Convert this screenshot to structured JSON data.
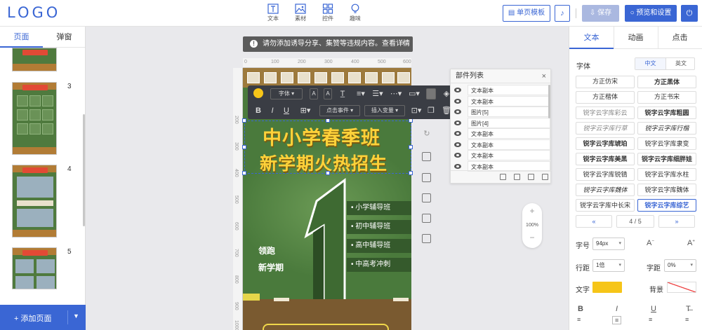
{
  "app": {
    "logo": "LOGO"
  },
  "toolbar": {
    "insert_items": [
      {
        "label": "文本",
        "icon": "text-icon"
      },
      {
        "label": "素材",
        "icon": "image-icon"
      },
      {
        "label": "控件",
        "icon": "widget-icon"
      },
      {
        "label": "趣味",
        "icon": "fun-bulb-icon"
      }
    ],
    "single_page_template": "单页模板",
    "music_icon": "music-note-icon",
    "save": "保存",
    "preview_settings": "预览和设置",
    "power_icon": "power-icon"
  },
  "left_panel": {
    "tabs": [
      "页面",
      "弹窗"
    ],
    "active_tab": "页面",
    "page_numbers": [
      "3",
      "4",
      "5"
    ],
    "add_page": "添加页面"
  },
  "canvas": {
    "notice": "请勿添加诱导分享、集赞等违规内容。查看详情",
    "notice_close": "×",
    "ruler_h": [
      "0",
      "100",
      "200",
      "300",
      "400",
      "500",
      "600"
    ],
    "ruler_v": [
      "200",
      "300",
      "400",
      "500",
      "600",
      "700",
      "800",
      "900",
      "1000"
    ],
    "zoom": "100%",
    "zoom_in": "+",
    "zoom_out": "−"
  },
  "poster": {
    "title_line1": "中小学春季班",
    "title_line2": "新学期火热招生",
    "big_number": "1",
    "bullets": [
      "小学辅导班",
      "初中辅导班",
      "高中辅导班",
      "中高考冲刺"
    ],
    "lead_line1": "领跑",
    "lead_line2": "新学期"
  },
  "edit_toolbar": {
    "font_select": "字体",
    "click_event": "点击事件",
    "insert_variable": "插入变量",
    "color": "#f6c518"
  },
  "parts_panel": {
    "title": "部件列表",
    "close": "×",
    "items": [
      "文本副本",
      "文本副本",
      "图片[5]",
      "图片[4]",
      "文本副本",
      "文本副本",
      "文本副本",
      "文本副本"
    ]
  },
  "right_panel": {
    "tabs": [
      "文本",
      "动画",
      "点击"
    ],
    "active_tab": "文本",
    "font_label": "字体",
    "lang_options": [
      "中文",
      "英文"
    ],
    "active_lang": "中文",
    "fonts": [
      "方正仿宋",
      "方正黑体",
      "方正楷体",
      "方正书宋",
      "锐字云字库彩云",
      "锐字云字库粗圆",
      "锐字云字库行草",
      "锐字云字库行楷",
      "锐字云字库琥珀",
      "锐字云字库隶变",
      "锐字云字库美黑",
      "锐字云字库细胖娃",
      "锐字云字库锐锖",
      "锐字云字库水柱",
      "锐字云字库魏体",
      "锐字云字库魏体",
      "锐字云字库中长宋",
      "锐字云字库综艺"
    ],
    "selected_font": "锐字云字库综艺",
    "pager_prev": "«",
    "pager_page": "4 / 5",
    "pager_next": "»",
    "size_label": "字号",
    "size_value": "94px",
    "line_height_label": "行距",
    "line_height_value": "1倍",
    "letter_spacing_label": "字距",
    "letter_spacing_value": "0%",
    "text_color_label": "文字",
    "text_color": "#f6c518",
    "bg_label": "背景",
    "bg_color": "none"
  }
}
